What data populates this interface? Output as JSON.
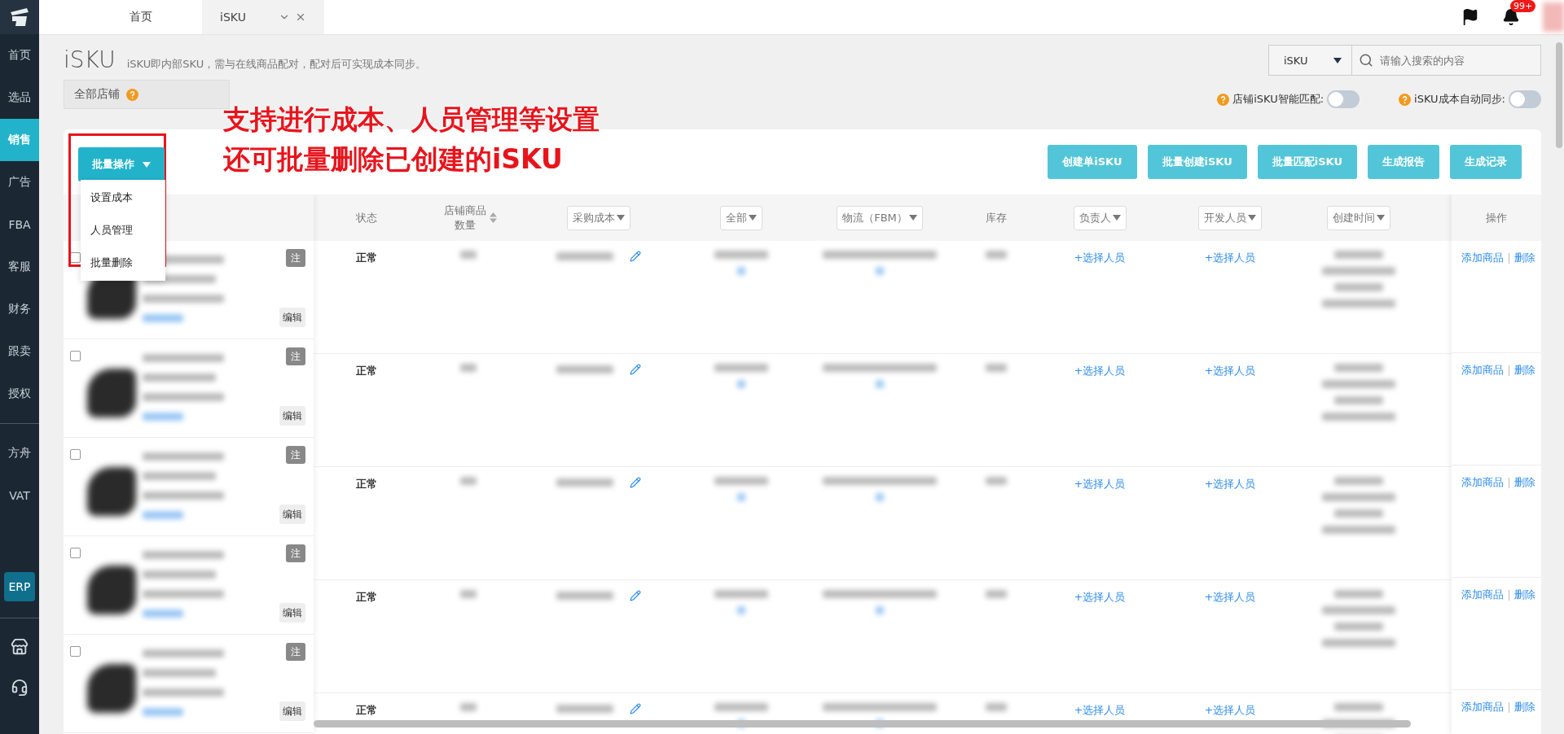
{
  "sidebar": {
    "items": [
      {
        "label": "首页",
        "selected": false
      },
      {
        "label": "选品",
        "selected": false
      },
      {
        "label": "销售",
        "selected": true
      },
      {
        "label": "广告",
        "selected": false
      },
      {
        "label": "FBA",
        "selected": false
      },
      {
        "label": "客服",
        "selected": false
      },
      {
        "label": "财务",
        "selected": false
      },
      {
        "label": "跟卖",
        "selected": false
      },
      {
        "label": "授权",
        "selected": false
      }
    ],
    "tools": [
      "方舟",
      "VAT"
    ],
    "badge": "ERP"
  },
  "tabs": [
    {
      "label": "首页",
      "selected": false,
      "closable": false
    },
    {
      "label": "iSKU",
      "selected": true,
      "closable": true
    }
  ],
  "top_bar": {
    "notification_count": "99+"
  },
  "header": {
    "title": "iSKU",
    "description": "iSKU即内部SKU，需与在线商品配对，配对后可实现成本同步。"
  },
  "store_filter": {
    "label": "全部店铺"
  },
  "search": {
    "scope": "iSKU",
    "placeholder": "请输入搜索的内容"
  },
  "toggles": [
    {
      "label": "店铺iSKU智能匹配:",
      "on": false
    },
    {
      "label": "iSKU成本自动同步:",
      "on": false
    }
  ],
  "bulk_menu": {
    "label": "批量操作",
    "expanded": true,
    "items": [
      "设置成本",
      "人员管理",
      "批量删除"
    ]
  },
  "actions": [
    "创建单iSKU",
    "批量创建iSKU",
    "批量匹配iSKU",
    "生成报告",
    "生成记录"
  ],
  "annotation": {
    "lines": [
      "支持进行成本、人员管理等设置",
      "还可批量删除已创建的iSKU"
    ]
  },
  "table": {
    "columns": [
      {
        "label": "状态",
        "kind": "plain"
      },
      {
        "label": "店铺商品数量",
        "kind": "sort"
      },
      {
        "label": "采购成本",
        "kind": "filter"
      },
      {
        "label": "全部",
        "kind": "filter"
      },
      {
        "label": "物流（FBM）",
        "kind": "filter"
      },
      {
        "label": "库存",
        "kind": "plain"
      },
      {
        "label": "负责人",
        "kind": "filter"
      },
      {
        "label": "开发人员",
        "kind": "filter"
      },
      {
        "label": "创建时间",
        "kind": "filter"
      }
    ],
    "action_column": "操作",
    "rows": [
      {
        "checked": false,
        "note": "注",
        "edit": "编辑",
        "status": "正常",
        "owner": "+选择人员",
        "developer": "+选择人员",
        "actions": [
          "添加商品",
          "删除"
        ]
      },
      {
        "checked": false,
        "note": "注",
        "edit": "编辑",
        "status": "正常",
        "owner": "+选择人员",
        "developer": "+选择人员",
        "actions": [
          "添加商品",
          "删除"
        ]
      },
      {
        "checked": false,
        "note": "注",
        "edit": "编辑",
        "status": "正常",
        "owner": "+选择人员",
        "developer": "+选择人员",
        "actions": [
          "添加商品",
          "删除"
        ]
      },
      {
        "checked": false,
        "note": "注",
        "edit": "编辑",
        "status": "正常",
        "owner": "+选择人员",
        "developer": "+选择人员",
        "actions": [
          "添加商品",
          "删除"
        ]
      },
      {
        "checked": false,
        "note": "注",
        "edit": "编辑",
        "status": "正常",
        "owner": "+选择人员",
        "developer": "+选择人员",
        "actions": [
          "添加商品",
          "删除"
        ]
      }
    ]
  }
}
